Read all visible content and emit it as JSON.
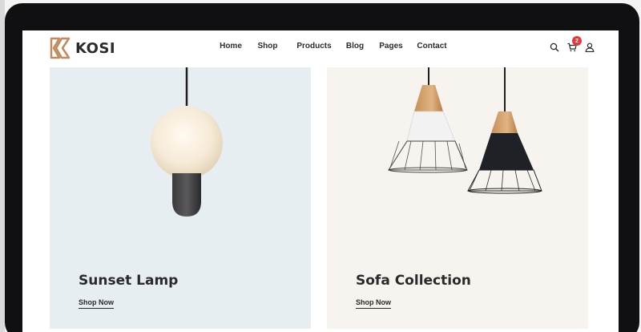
{
  "brand": {
    "name": "KOSI",
    "accent": "#c28a5a"
  },
  "nav": {
    "items": [
      {
        "label": "Home"
      },
      {
        "label": "Shop"
      },
      {
        "label": "Products"
      },
      {
        "label": "Blog"
      },
      {
        "label": "Pages"
      },
      {
        "label": "Contact"
      }
    ]
  },
  "header_icons": {
    "search": "search-icon",
    "cart": "cart-icon",
    "account": "user-icon",
    "cart_count": "2",
    "badge_color": "#e23b3b"
  },
  "cards": [
    {
      "title": "Sunset Lamp",
      "link": "Shop Now",
      "background": "#e7eef2"
    },
    {
      "title": "Sofa Collection",
      "link": "Shop Now",
      "background": "#f7f3ef"
    }
  ]
}
